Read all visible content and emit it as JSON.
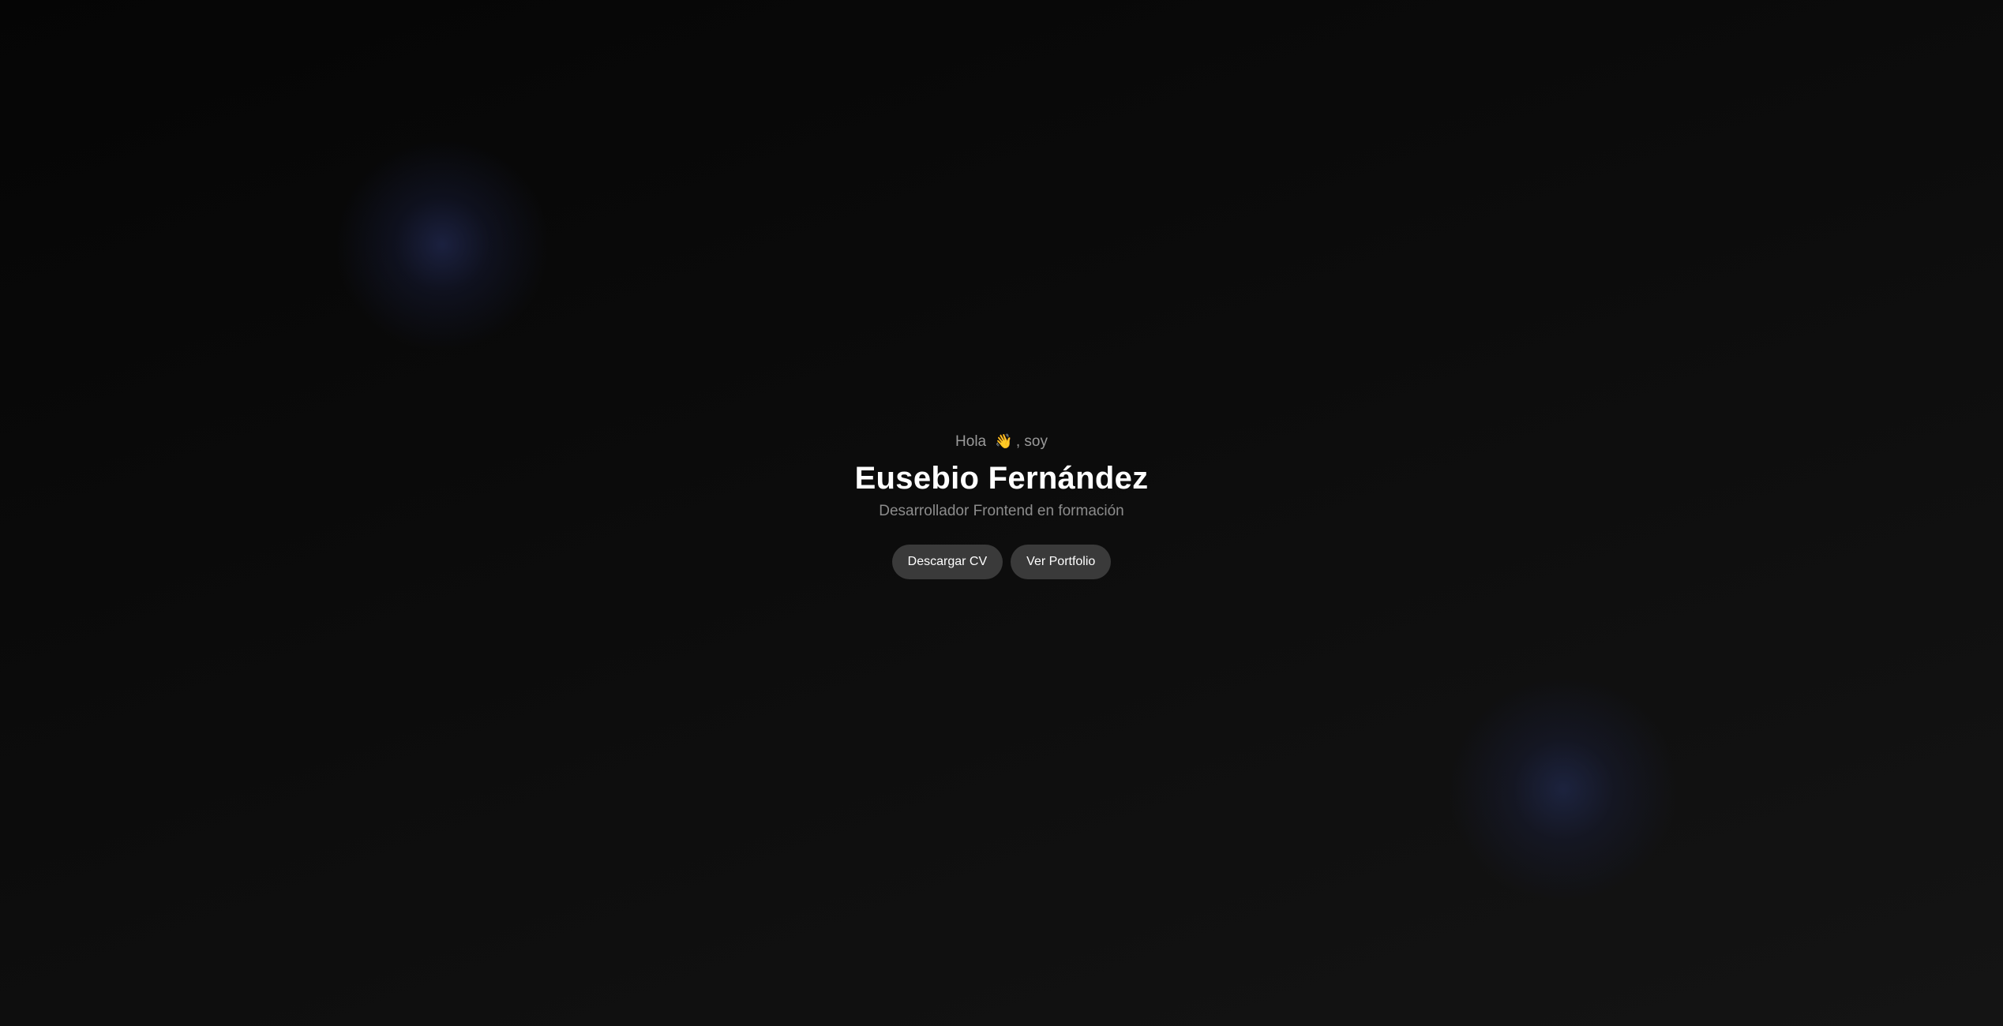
{
  "hero": {
    "greeting_prefix": "Hola",
    "wave_emoji": "👋",
    "greeting_suffix": ", soy",
    "name": "Eusebio Fernández",
    "role": "Desarrollador Frontend en formación"
  },
  "actions": {
    "download_cv_label": "Descargar CV",
    "portfolio_label": "Ver Portfolio"
  },
  "colors": {
    "background_dark": "#050505",
    "background_light": "#141414",
    "button_bg": "#3a3a3a",
    "muted_text": "#9a9a9a",
    "glow": "#1c2242"
  }
}
